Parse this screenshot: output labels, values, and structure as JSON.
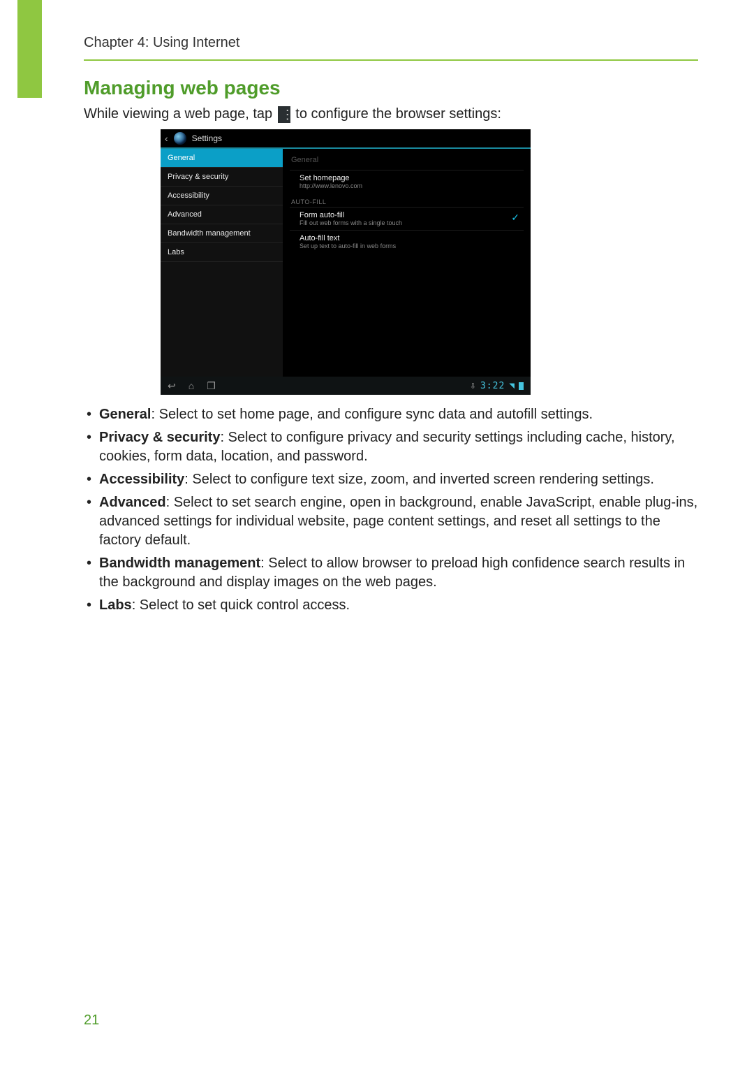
{
  "header": {
    "chapter": "Chapter 4: Using Internet"
  },
  "section": {
    "title": "Managing web pages"
  },
  "intro": {
    "before": "While viewing a web page, tap ",
    "after": " to configure the browser settings:",
    "icon_name": "overflow-menu-icon"
  },
  "screenshot": {
    "topbar_title": "Settings",
    "sidebar": [
      {
        "label": "General",
        "active": true
      },
      {
        "label": "Privacy & security",
        "active": false
      },
      {
        "label": "Accessibility",
        "active": false
      },
      {
        "label": "Advanced",
        "active": false
      },
      {
        "label": "Bandwidth management",
        "active": false
      },
      {
        "label": "Labs",
        "active": false
      }
    ],
    "main_heading": "General",
    "set_homepage": {
      "title": "Set homepage",
      "sub": "http://www.lenovo.com"
    },
    "autofill_label": "AUTO-FILL",
    "form_autofill": {
      "title": "Form auto-fill",
      "sub": "Fill out web forms with a single touch",
      "checked": true
    },
    "autofill_text": {
      "title": "Auto-fill text",
      "sub": "Set up text to auto-fill in web forms"
    },
    "statusbar": {
      "time": "3:22"
    }
  },
  "bullets": [
    {
      "term": "General",
      "desc": ": Select to set home page, and configure sync data and autofill settings."
    },
    {
      "term": "Privacy & security",
      "desc": ": Select to configure privacy and security settings including cache, history, cookies, form data, location, and password."
    },
    {
      "term": "Accessibility",
      "desc": ": Select to configure text size, zoom, and inverted screen rendering settings."
    },
    {
      "term": "Advanced",
      "desc": ": Select to set search engine, open in background, enable JavaScript, enable plug-ins, advanced settings for individual website, page content settings, and reset all settings to the factory default."
    },
    {
      "term": "Bandwidth management",
      "desc": ": Select to allow browser to preload high confidence search results in the background and display images on the web pages."
    },
    {
      "term": "Labs",
      "desc": ": Select to set quick control access."
    }
  ],
  "page_number": "21"
}
